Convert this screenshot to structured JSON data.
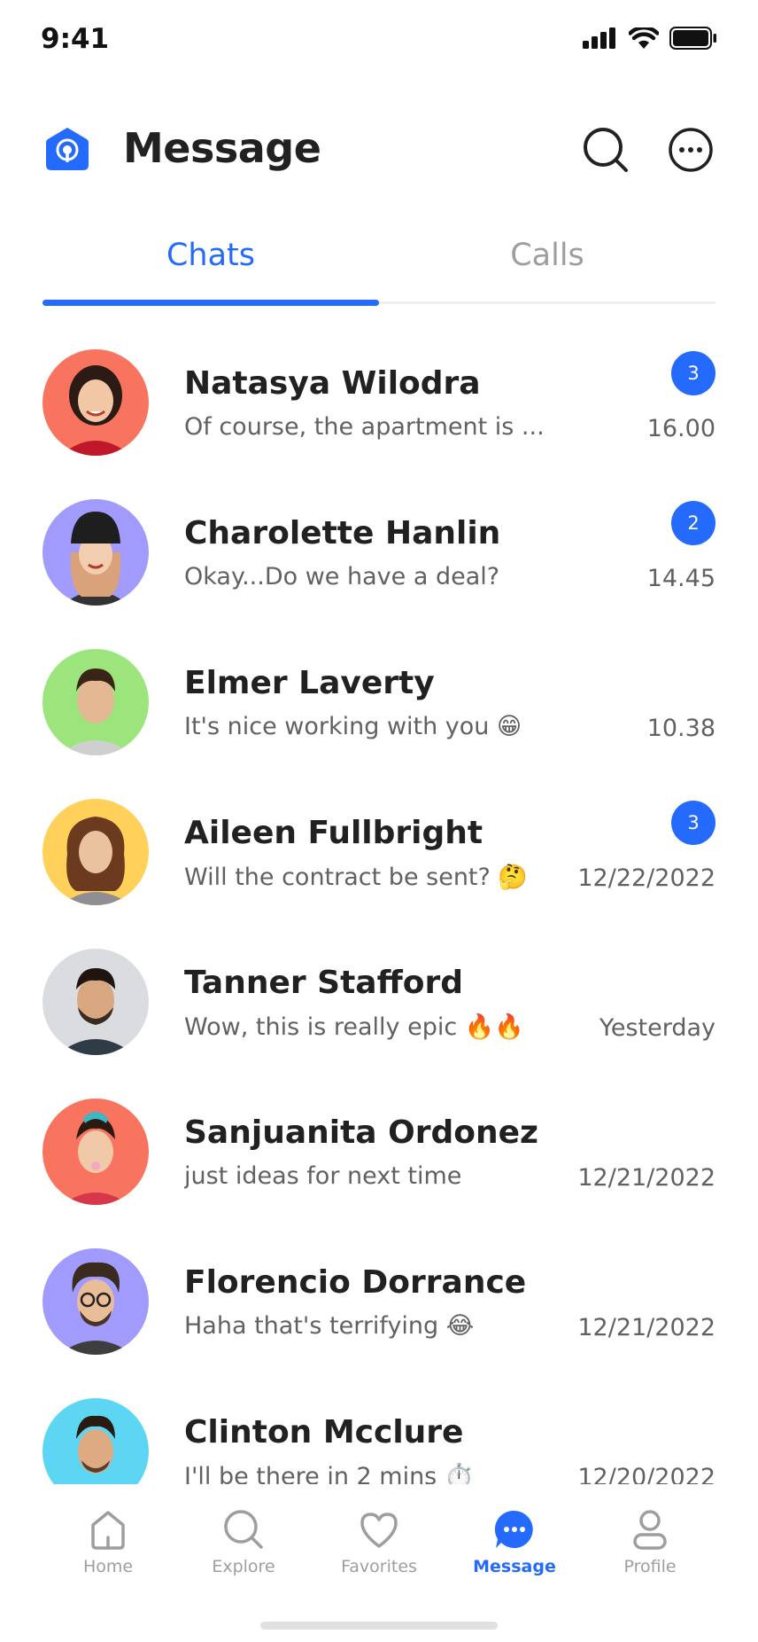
{
  "status_bar": {
    "time": "9:41"
  },
  "header": {
    "title": "Message"
  },
  "tabs": [
    {
      "label": "Chats",
      "active": true
    },
    {
      "label": "Calls",
      "active": false
    }
  ],
  "chats": [
    {
      "name": "Natasya Wilodra",
      "message": "Of course, the apartment is ...",
      "time": "16.00",
      "badge": "3",
      "avatar_bg": "#F8745E"
    },
    {
      "name": "Charolette Hanlin",
      "message": "Okay...Do we have a deal?",
      "time": "14.45",
      "badge": "2",
      "avatar_bg": "#A29BFE"
    },
    {
      "name": "Elmer Laverty",
      "message": "It's nice working with you 😁",
      "time": "10.38",
      "badge": "",
      "avatar_bg": "#9CE57D"
    },
    {
      "name": "Aileen Fullbright",
      "message": "Will the contract be sent? 🤔",
      "time": "12/22/2022",
      "badge": "3",
      "avatar_bg": "#FFD05A"
    },
    {
      "name": "Tanner Stafford",
      "message": "Wow, this is really epic 🔥🔥",
      "time": "Yesterday",
      "badge": "",
      "avatar_bg": "#DADCE0"
    },
    {
      "name": "Sanjuanita Ordonez",
      "message": "just ideas for next time",
      "time": "12/21/2022",
      "badge": "",
      "avatar_bg": "#F8745E"
    },
    {
      "name": "Florencio Dorrance",
      "message": "Haha that's terrifying 😂",
      "time": "12/21/2022",
      "badge": "",
      "avatar_bg": "#A29BFE"
    },
    {
      "name": "Clinton Mcclure",
      "message": "I'll be there in 2 mins ⏱️",
      "time": "12/20/2022",
      "badge": "",
      "avatar_bg": "#5DD6F4"
    }
  ],
  "bottom_nav": [
    {
      "label": "Home",
      "icon": "home-icon",
      "active": false
    },
    {
      "label": "Explore",
      "icon": "search-icon",
      "active": false
    },
    {
      "label": "Favorites",
      "icon": "heart-icon",
      "active": false
    },
    {
      "label": "Message",
      "icon": "chat-bubble-icon",
      "active": true
    },
    {
      "label": "Profile",
      "icon": "profile-icon",
      "active": false
    }
  ],
  "colors": {
    "accent": "#246BFD",
    "text": "#212121",
    "muted": "#616161",
    "inactive": "#9E9E9E"
  }
}
